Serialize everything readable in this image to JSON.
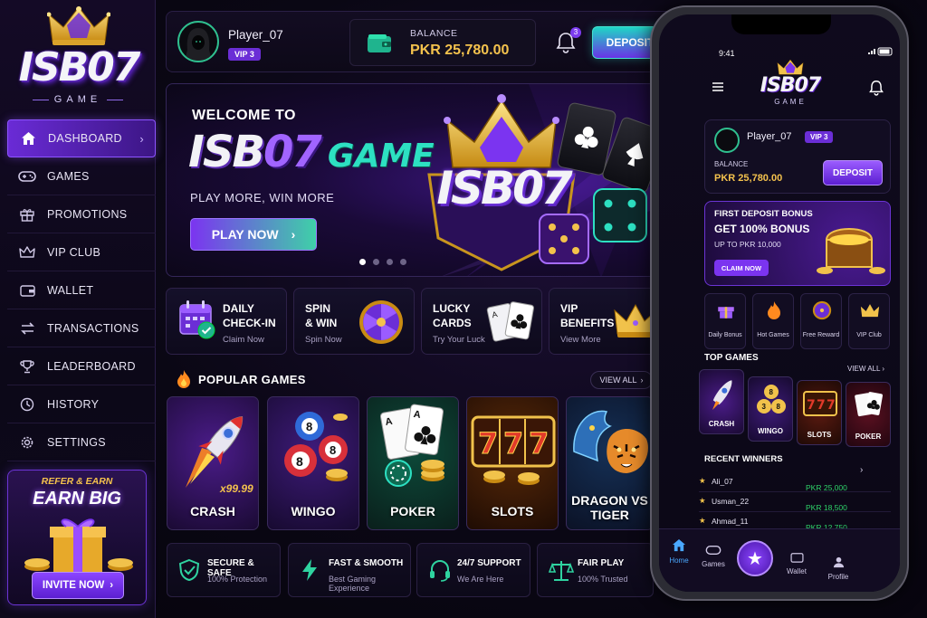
{
  "brand": {
    "logo_text": "ISB07",
    "logo_sub": "GAME"
  },
  "sidebar": {
    "items": [
      {
        "label": "DASHBOARD",
        "icon": "home-icon",
        "active": true
      },
      {
        "label": "GAMES",
        "icon": "gamepad-icon"
      },
      {
        "label": "PROMOTIONS",
        "icon": "gift-icon"
      },
      {
        "label": "VIP CLUB",
        "icon": "crown-icon"
      },
      {
        "label": "WALLET",
        "icon": "wallet-icon"
      },
      {
        "label": "TRANSACTIONS",
        "icon": "transfer-icon"
      },
      {
        "label": "LEADERBOARD",
        "icon": "trophy-icon"
      },
      {
        "label": "HISTORY",
        "icon": "history-icon"
      },
      {
        "label": "SETTINGS",
        "icon": "gear-icon"
      }
    ],
    "refer": {
      "top": "REFER & EARN",
      "big": "EARN BIG",
      "button": "INVITE NOW"
    }
  },
  "topbar": {
    "player_name": "Player_07",
    "vip": "VIP 3",
    "balance_label": "BALANCE",
    "balance_value": "PKR 25,780.00",
    "notification_count": "3",
    "deposit_label": "DEPOSIT"
  },
  "hero": {
    "welcome": "WELCOME TO",
    "title_a": "ISB",
    "title_b": "07",
    "title_c": "GAME",
    "tagline": "PLAY MORE, WIN MORE",
    "play_label": "PLAY NOW",
    "art_text": "ISB07",
    "slides": 4,
    "active_slide": 1
  },
  "quick_actions": [
    {
      "title_1": "DAILY",
      "title_2": "CHECK-IN",
      "sub": "Claim Now",
      "icon": "calendar-check-icon"
    },
    {
      "title_1": "SPIN",
      "title_2": "& WIN",
      "sub": "Spin Now",
      "icon": "wheel-icon"
    },
    {
      "title_1": "LUCKY",
      "title_2": "CARDS",
      "sub": "Try Your Luck",
      "icon": "cards-icon"
    },
    {
      "title_1": "VIP",
      "title_2": "BENEFITS",
      "sub": "View More",
      "icon": "crown-icon"
    }
  ],
  "popular": {
    "title": "POPULAR GAMES",
    "view_all": "VIEW ALL",
    "games": [
      {
        "name": "CRASH",
        "extra": "x99.99"
      },
      {
        "name": "WINGO"
      },
      {
        "name": "POKER"
      },
      {
        "name": "SLOTS"
      },
      {
        "name": "DRAGON VS TIGER"
      }
    ]
  },
  "features": [
    {
      "title": "SECURE & SAFE",
      "sub": "100% Protection",
      "icon": "shield-icon",
      "color": "#2fd3a0"
    },
    {
      "title": "FAST & SMOOTH",
      "sub": "Best Gaming Experience",
      "icon": "bolt-icon",
      "color": "#2fd3a0"
    },
    {
      "title": "24/7 SUPPORT",
      "sub": "We Are Here",
      "icon": "headset-icon",
      "color": "#2fd3a0"
    },
    {
      "title": "FAIR PLAY",
      "sub": "100% Trusted",
      "icon": "scales-icon",
      "color": "#2fd3a0"
    }
  ],
  "phone": {
    "time": "9:41",
    "player_name": "Player_07",
    "vip": "VIP 3",
    "balance_label": "BALANCE",
    "balance_value": "PKR 25,780.00",
    "deposit_label": "DEPOSIT",
    "bonus": {
      "line1": "FIRST DEPOSIT BONUS",
      "line2": "GET 100% BONUS",
      "line3": "UP TO PKR 10,000",
      "button": "CLAIM NOW"
    },
    "shortcuts": [
      "Daily Bonus",
      "Hot Games",
      "Free Reward",
      "VIP Club"
    ],
    "top_games_title": "TOP GAMES",
    "view_all": "VIEW ALL",
    "top_games": [
      "CRASH",
      "WINGO",
      "SLOTS",
      "POKER"
    ],
    "recent_title": "RECENT WINNERS",
    "winners": [
      {
        "name": "Ali_07",
        "amount": "PKR 25,000"
      },
      {
        "name": "Usman_22",
        "amount": "PKR 18,500"
      },
      {
        "name": "Ahmad_11",
        "amount": "PKR 12,750"
      }
    ],
    "tabs": [
      "Home",
      "Games",
      "",
      "Wallet",
      "Profile"
    ]
  },
  "colors": {
    "accent": "#7b34f0",
    "teal": "#2de0c2",
    "gold": "#f4c24d"
  }
}
